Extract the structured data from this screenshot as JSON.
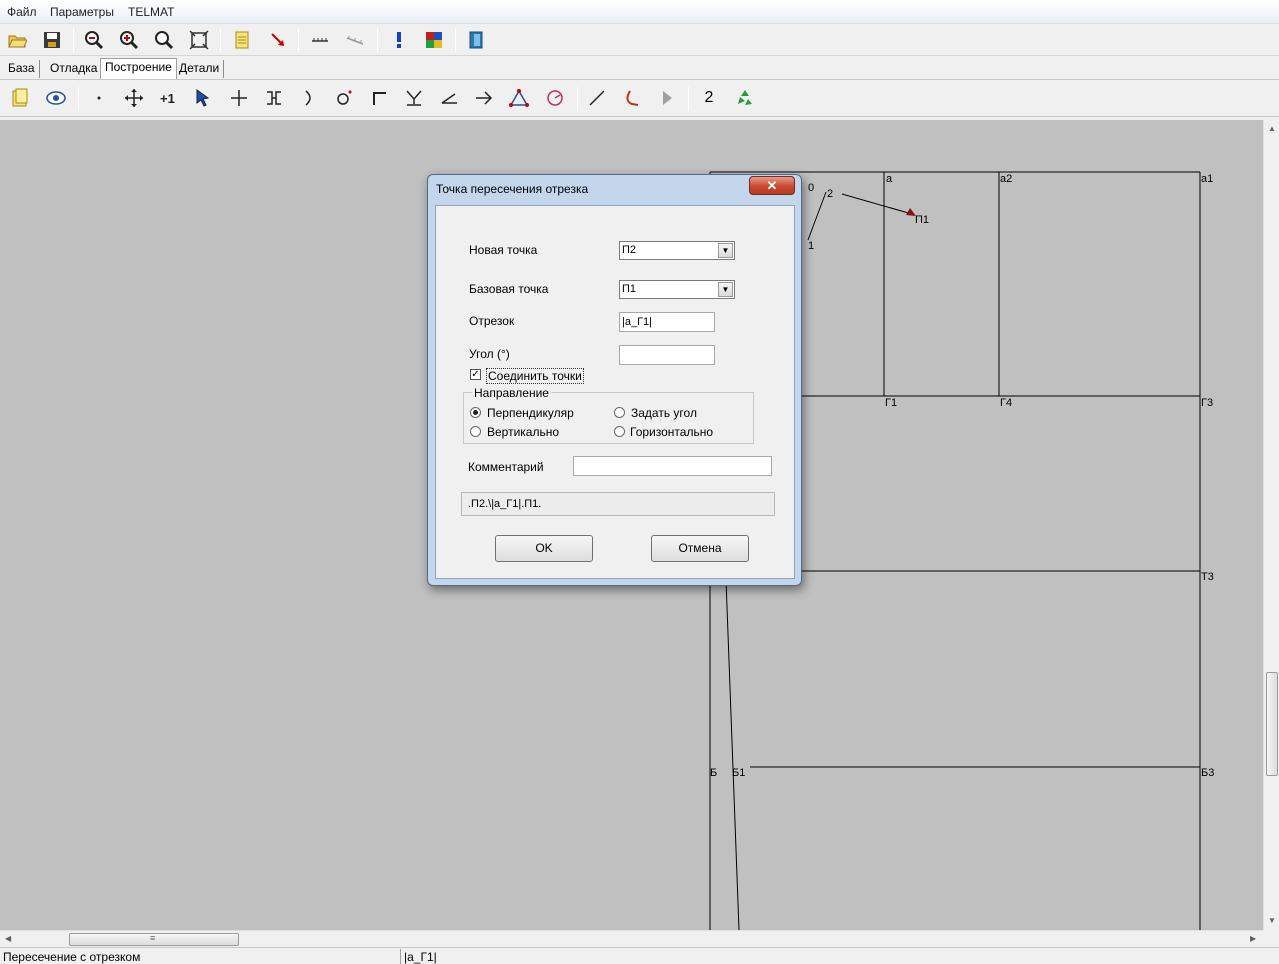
{
  "menu": {
    "file": "Файл",
    "params": "Параметры",
    "telmat": "TELMAT"
  },
  "toolbar1": [
    "open-icon",
    "save-icon",
    "zoom-out-icon",
    "zoom-in-icon",
    "zoom-icon",
    "fit-icon",
    "note-icon",
    "pointer-icon",
    "measure-icon",
    "measure-angle-icon",
    "info-icon",
    "palette-icon",
    "exit-icon"
  ],
  "tabs": {
    "base": "База",
    "debug": "Отладка",
    "build": "Построение",
    "details": "Детали",
    "active": "build"
  },
  "toolbar2": {
    "number_label": "2"
  },
  "canvas_labels": {
    "p0": "0",
    "p2": "2",
    "p1": "1",
    "pa": "а",
    "pa2": "а2",
    "pa1": "а1",
    "P1": "П1",
    "G1": "Г1",
    "G4": "Г4",
    "G3": "Г3",
    "T3": "Т3",
    "B": "Б",
    "B1": "Б1",
    "B3": "Б3"
  },
  "dialog": {
    "title": "Точка пересечения отрезка",
    "close": "✕",
    "new_point_label": "Новая точка",
    "new_point_value": "П2",
    "base_point_label": "Базовая точка",
    "base_point_value": "П1",
    "segment_label": "Отрезок",
    "segment_value": "|а_Г1|",
    "angle_label": "Угол (°)",
    "angle_value": "",
    "connect_label": "Соединить точки",
    "connect_checked": "✓",
    "direction_legend": "Направление",
    "perpendicular": "Перпендикуляр",
    "set_angle": "Задать угол",
    "vertical": "Вертикально",
    "horizontal": "Горизонтально",
    "comment_label": "Комментарий",
    "comment_value": "",
    "preview": ".П2.\\|а_Г1|.П1.",
    "ok": "OK",
    "cancel": "Отмена"
  },
  "status": {
    "left": "Пересечение с отрезком",
    "right": "|а_Г1|"
  },
  "scroll": {
    "grip": "≡",
    "left": "◀",
    "right": "▶",
    "up": "▲",
    "down": "▼"
  }
}
